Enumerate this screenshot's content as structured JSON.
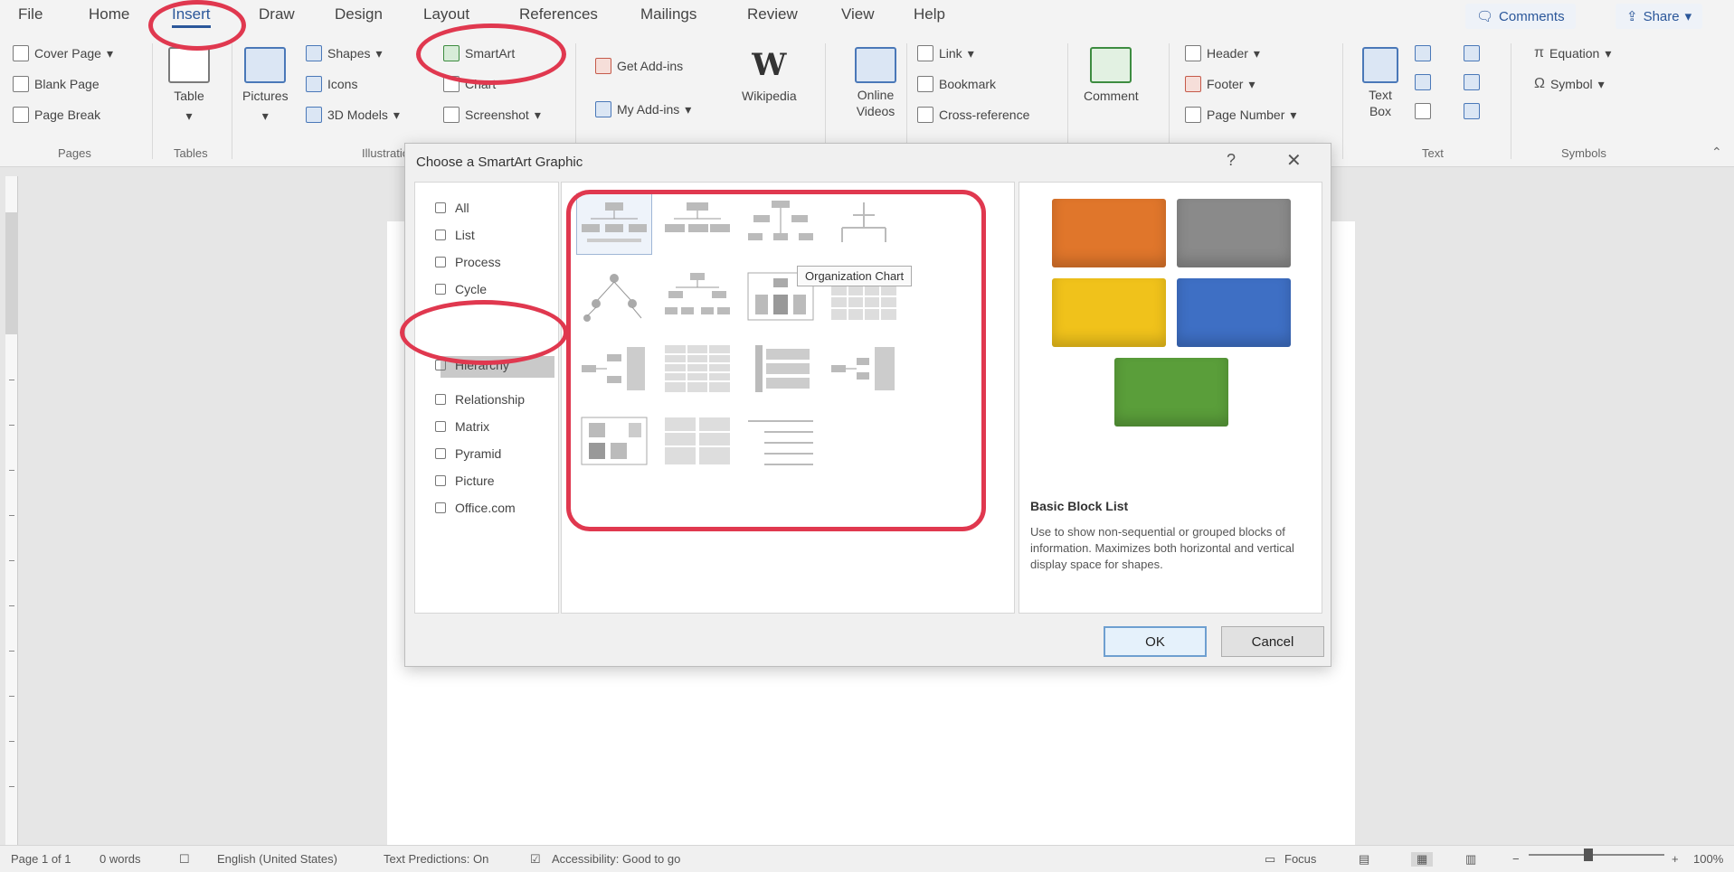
{
  "ribbon": {
    "tabs": [
      "File",
      "Home",
      "Insert",
      "Draw",
      "Design",
      "Layout",
      "References",
      "Mailings",
      "Review",
      "View",
      "Help"
    ],
    "active_tab": "Insert",
    "comments_label": "Comments",
    "share_label": "Share",
    "pages": {
      "cover_page": "Cover Page",
      "blank_page": "Blank Page",
      "page_break": "Page Break",
      "group": "Pages"
    },
    "tables": {
      "table": "Table",
      "group": "Tables"
    },
    "illustrations": {
      "pictures": "Pictures",
      "shapes": "Shapes",
      "icons": "Icons",
      "models_3d": "3D Models",
      "smartart": "SmartArt",
      "chart": "Chart",
      "screenshot": "Screenshot",
      "group": "Illustrations"
    },
    "addins": {
      "get_addins": "Get Add-ins",
      "my_addins": "My Add-ins",
      "wikipedia": "Wikipedia"
    },
    "media": {
      "online_videos": "Online Videos"
    },
    "links": {
      "link": "Link",
      "bookmark": "Bookmark",
      "cross_reference": "Cross-reference"
    },
    "comments": {
      "comment": "Comment"
    },
    "header_footer": {
      "header": "Header",
      "footer": "Footer",
      "page_number": "Page Number"
    },
    "text": {
      "text_box": "Text Box",
      "group": "Text"
    },
    "symbols": {
      "equation": "Equation",
      "symbol": "Symbol",
      "group": "Symbols"
    }
  },
  "dialog": {
    "title": "Choose a SmartArt Graphic",
    "help": "?",
    "close": "✕",
    "categories": [
      "All",
      "List",
      "Process",
      "Cycle",
      "Hierarchy",
      "Relationship",
      "Matrix",
      "Pyramid",
      "Picture",
      "Office.com"
    ],
    "selected_category": "Hierarchy",
    "tooltip": "Organization Chart",
    "preview": {
      "title": "Basic Block List",
      "description": "Use to show non-sequential or grouped blocks of information. Maximizes both horizontal and vertical display space for shapes.",
      "colors": [
        "#e0762b",
        "#8a8a8a",
        "#f0c21b",
        "#3e6fc4",
        "#5a9e3a"
      ]
    },
    "ok_label": "OK",
    "cancel_label": "Cancel"
  },
  "status_bar": {
    "page": "Page 1 of 1",
    "words": "0 words",
    "language": "English (United States)",
    "text_predictions": "Text Predictions: On",
    "accessibility": "Accessibility: Good to go",
    "focus": "Focus",
    "zoom": "100%"
  },
  "annotation_color": "#e0384f"
}
